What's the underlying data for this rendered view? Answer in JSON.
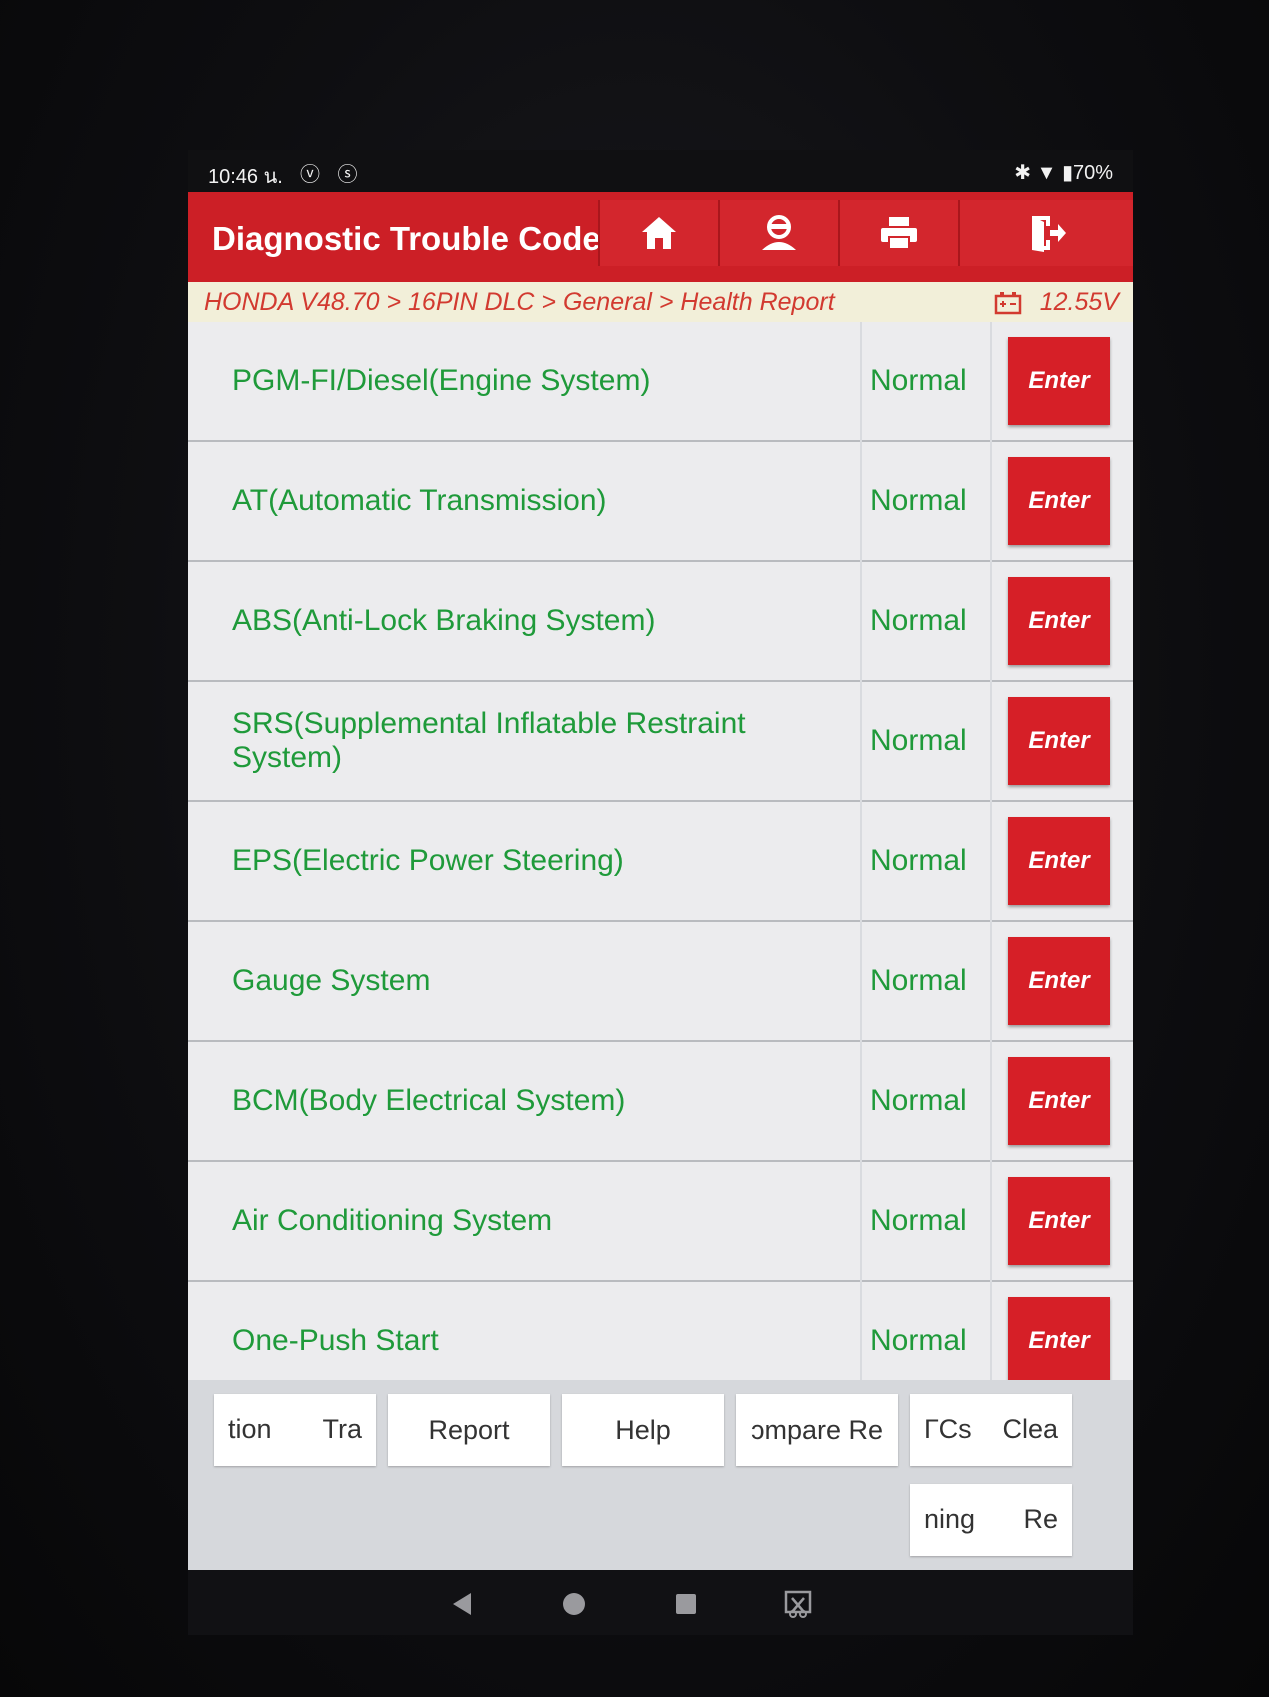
{
  "status_bar": {
    "time": "10:46 น.",
    "left_icons": "ⓥ ⓢ",
    "right_text": "✱ ▼ ▮70%"
  },
  "header": {
    "title": "Diagnostic Trouble Code",
    "buttons": [
      {
        "icon": "home-icon"
      },
      {
        "icon": "user-icon"
      },
      {
        "icon": "print-icon"
      },
      {
        "icon": "exit-icon"
      }
    ],
    "accent_color": "#cc1f26"
  },
  "breadcrumb": {
    "path": "HONDA V48.70 > 16PIN DLC > General > Health Report",
    "voltage": "12.55V",
    "battery_icon": "battery-icon"
  },
  "rows": [
    {
      "name": "PGM-FI/Diesel(Engine System)",
      "status": "Normal",
      "button": "Enter"
    },
    {
      "name": "AT(Automatic Transmission)",
      "status": "Normal",
      "button": "Enter"
    },
    {
      "name": "ABS(Anti-Lock Braking System)",
      "status": "Normal",
      "button": "Enter"
    },
    {
      "name": "SRS(Supplemental Inflatable Restraint System)",
      "status": "Normal",
      "button": "Enter"
    },
    {
      "name": "EPS(Electric Power Steering)",
      "status": "Normal",
      "button": "Enter"
    },
    {
      "name": "Gauge System",
      "status": "Normal",
      "button": "Enter"
    },
    {
      "name": "BCM(Body Electrical System)",
      "status": "Normal",
      "button": "Enter"
    },
    {
      "name": "Air Conditioning System",
      "status": "Normal",
      "button": "Enter"
    },
    {
      "name": "One-Push Start",
      "status": "Normal",
      "button": "Enter"
    }
  ],
  "toolbar": {
    "translation_a": "tion",
    "translation_b": "Tra",
    "report": "Report",
    "help": "Help",
    "compare": "ɔmpare Re",
    "clear_a": "ГCs",
    "clear_b": "Clea",
    "learning_a": "ning",
    "learning_b": "Re"
  },
  "nav": {
    "back": "back-icon",
    "home": "home-circle-icon",
    "recents": "recents-icon",
    "screenshot": "screenshot-icon"
  }
}
